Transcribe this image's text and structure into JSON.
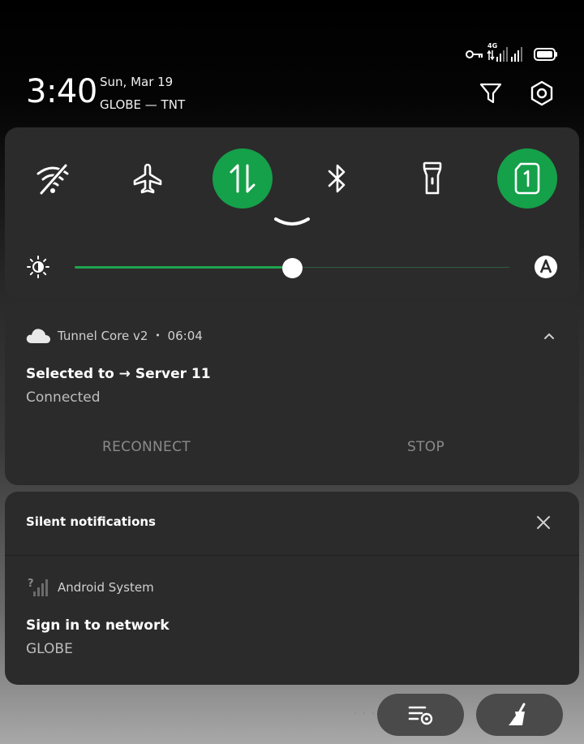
{
  "status": {
    "network_label": "4G"
  },
  "header": {
    "time": "3:40",
    "date": "Sun, Mar 19",
    "carrier": "GLOBE — TNT"
  },
  "brightness": {
    "level": 0.5
  },
  "vpn_notification": {
    "app_name": "Tunnel Core v2",
    "separator": "•",
    "time": "06:04",
    "title": "Selected to → Server 11",
    "subtitle": "Connected",
    "action_reconnect": "RECONNECT",
    "action_stop": "STOP"
  },
  "silent_section": {
    "header": "Silent notifications",
    "app_name": "Android System",
    "title": "Sign in to network",
    "subtitle": "GLOBE"
  },
  "bottom": {
    "dots": "· · ·"
  },
  "colors": {
    "accent": "#15a04a",
    "panel": "#2b2b2b"
  }
}
